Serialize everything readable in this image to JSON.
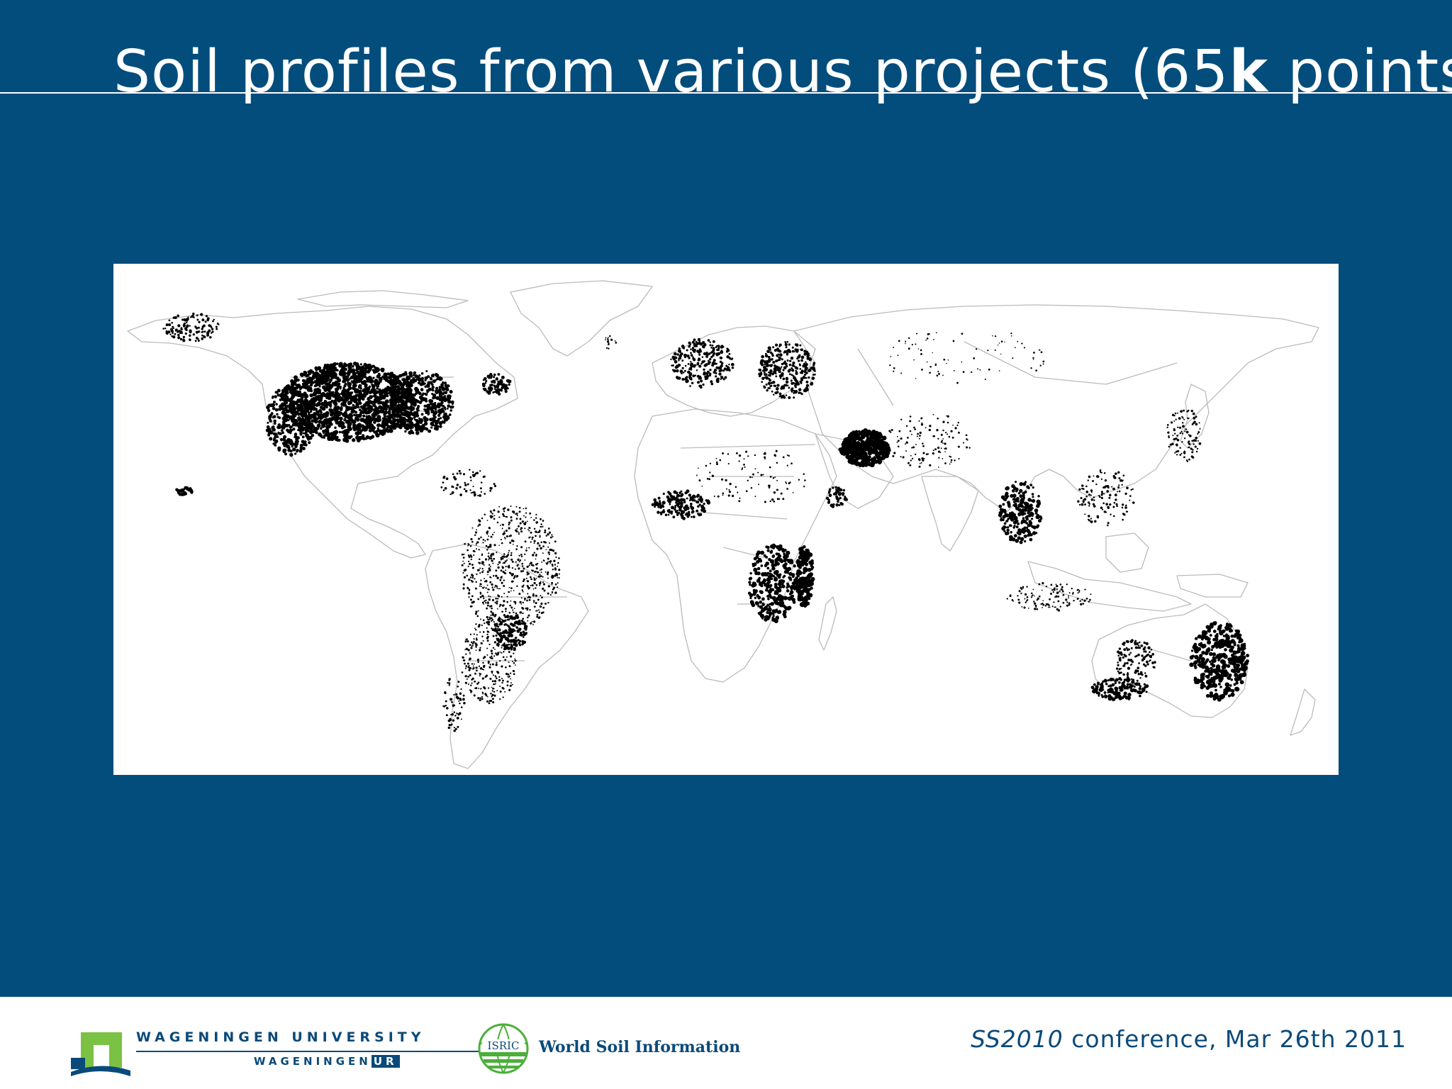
{
  "slide": {
    "title_prefix": "Soil profiles from various projects (65",
    "title_bold": "k",
    "title_suffix": " points)"
  },
  "map": {
    "background_color": "#ffffff",
    "point_color": "#000000",
    "outline_color": "#bbbbbb"
  },
  "footer": {
    "wur_line1": "WAGENINGEN UNIVERSITY",
    "wur_line2_prefix": "WAGENINGEN",
    "wur_line2_ur": "UR",
    "isric_badge": "ISRIC",
    "isric_text": "World Soil Information",
    "conference_italic": "SS2010",
    "conference_rest": " conference, Mar 26th 2011"
  },
  "colors": {
    "slide_background": "#034d7c",
    "footer_background": "#ffffff",
    "brand_blue": "#0a4a7a",
    "wur_green": "#7bc143",
    "isric_green": "#4caf3a"
  }
}
